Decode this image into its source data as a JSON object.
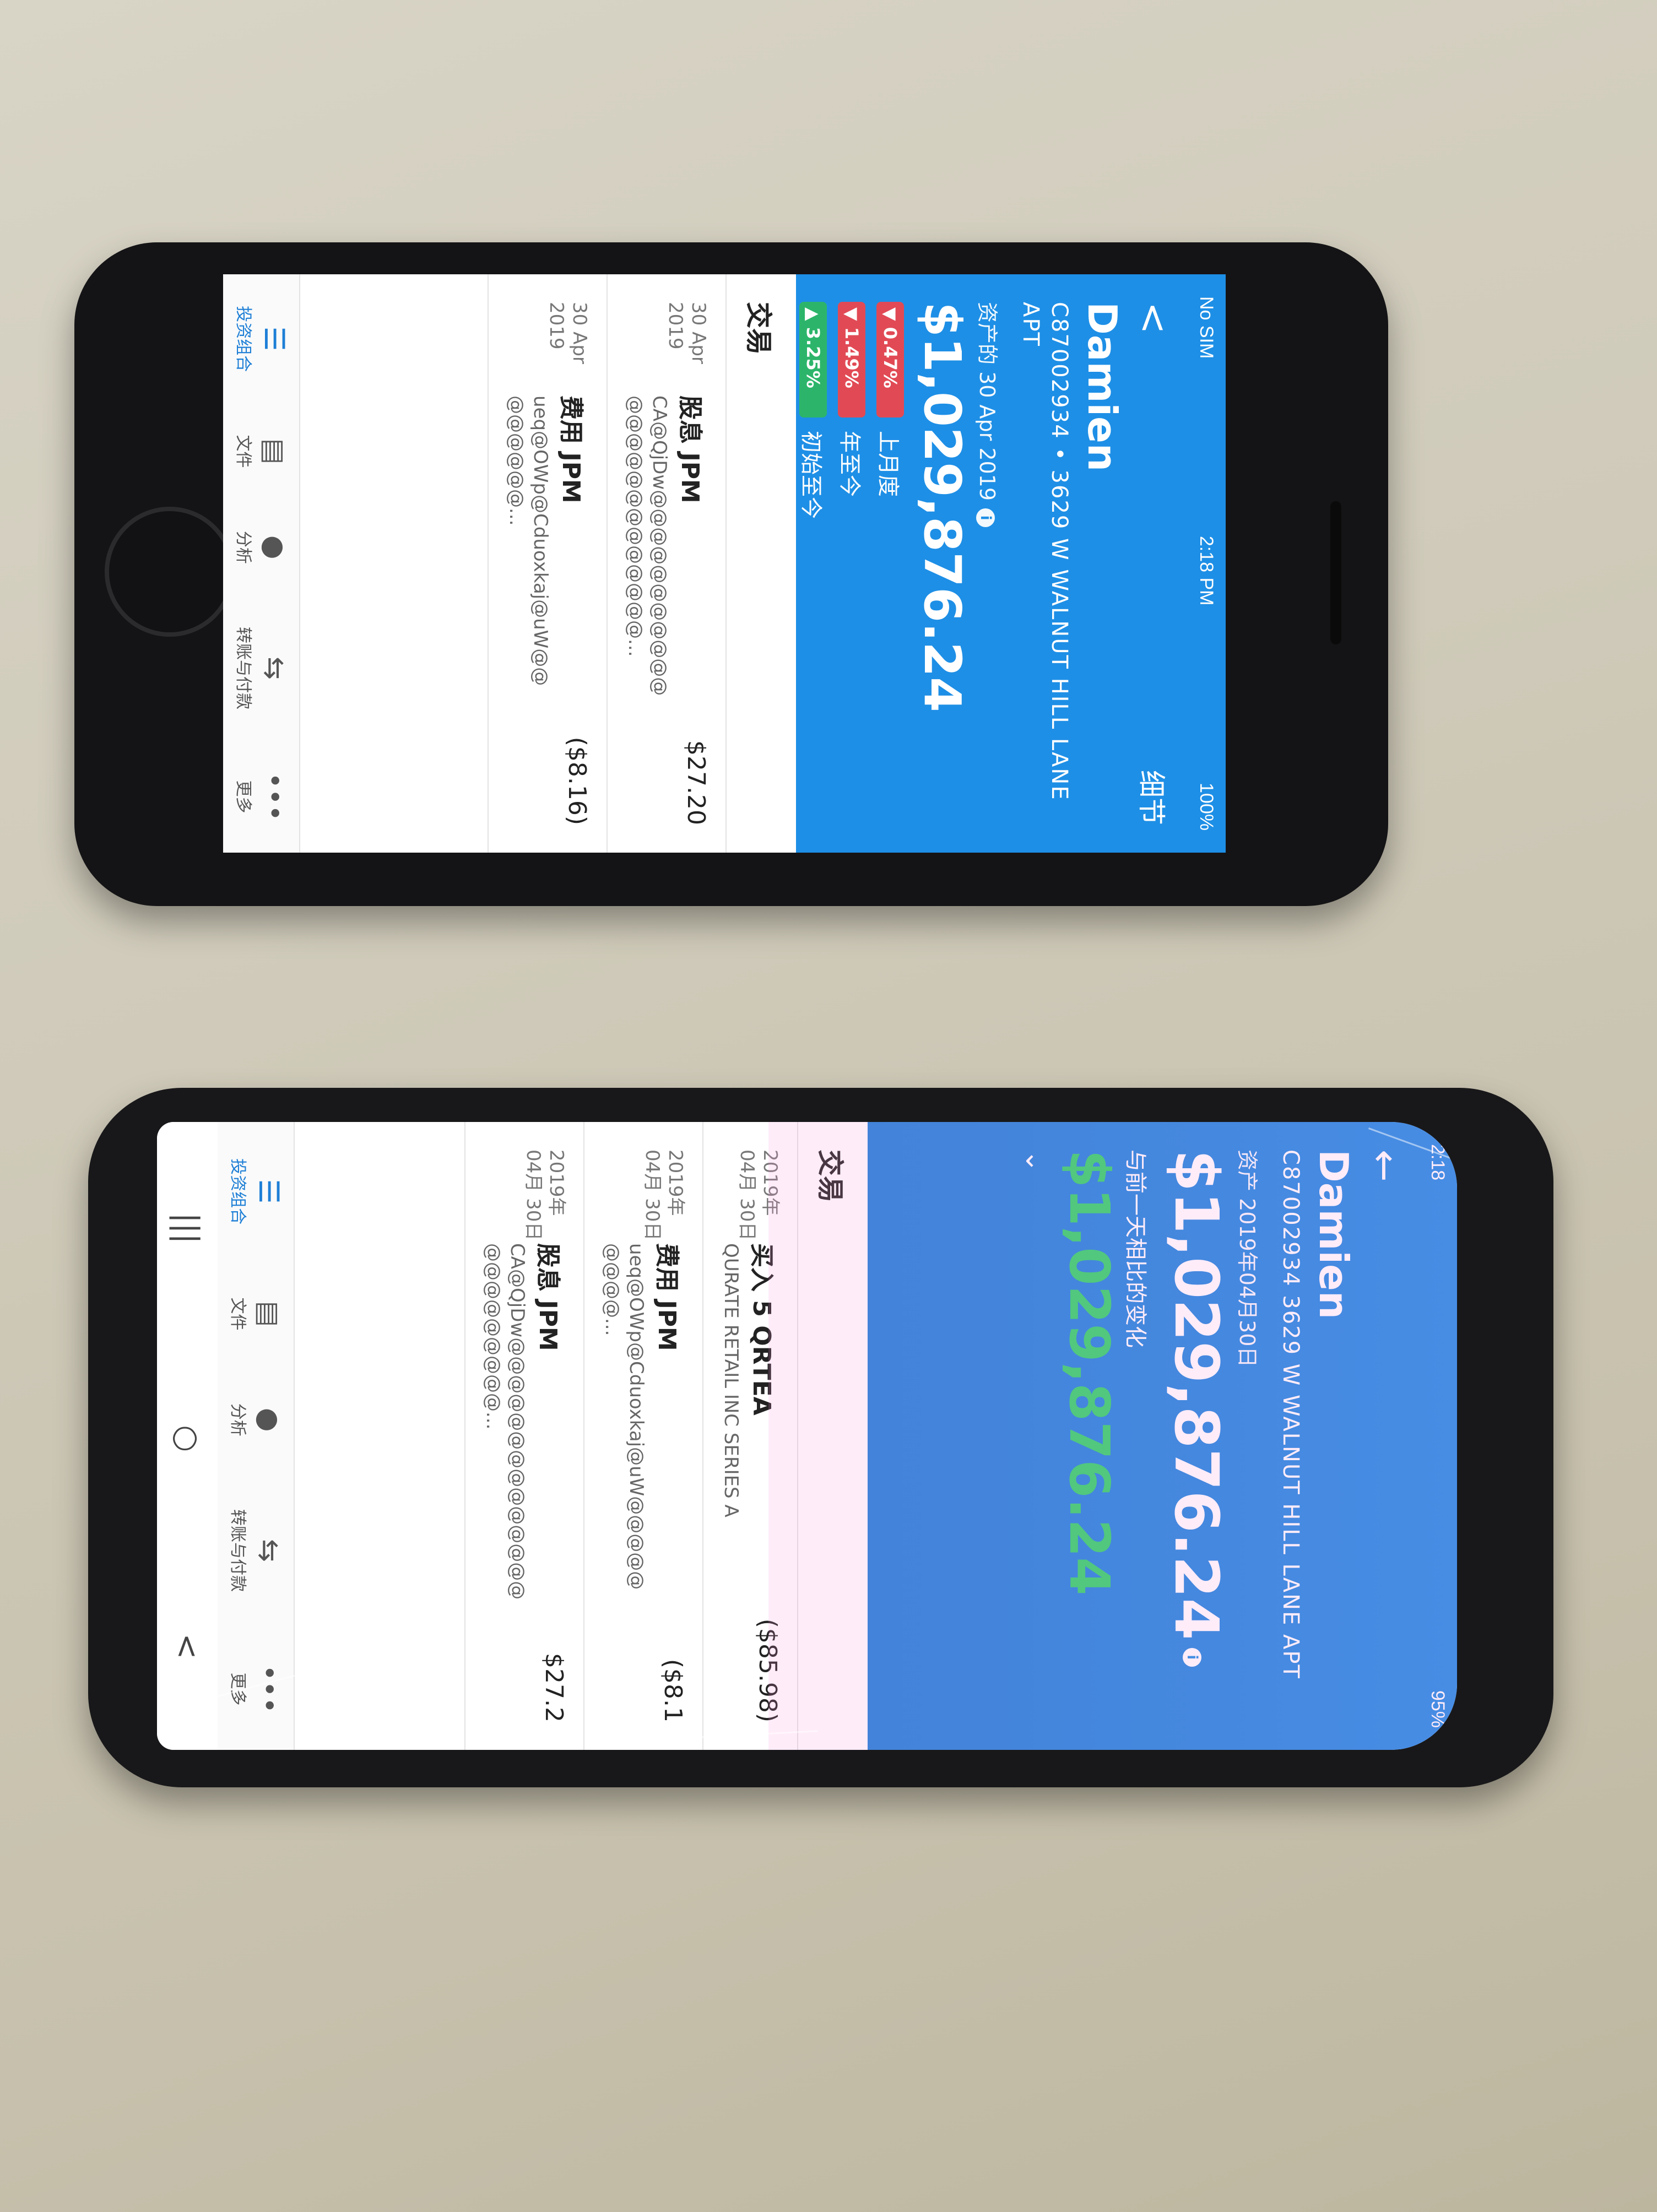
{
  "top_phone": {
    "status": {
      "carrier": "No SIM",
      "time": "2:18 PM",
      "battery": "100%"
    },
    "header": {
      "back": "<",
      "details": "细节",
      "name": "Damien",
      "account": "C87002934 • 3629 W WALNUT HILL LANE APT",
      "asset_label": "资产的 30 Apr 2019",
      "asset_value": "$1,029,876.24",
      "performance": [
        {
          "badge": "0.47%",
          "label": "上月度",
          "direction": "down"
        },
        {
          "badge": "1.49%",
          "label": "年至今",
          "direction": "down"
        },
        {
          "badge": "3.25%",
          "label": "初始至今",
          "direction": "up"
        }
      ]
    },
    "section_title": "交易",
    "transactions": [
      {
        "date": "30 Apr 2019",
        "type": "股息  JPM",
        "desc": "CA@QjDw@@@@@@@@@@@@@@@@@@@@@@@@...",
        "amount": "$27.20"
      },
      {
        "date": "30 Apr 2019",
        "type": "费用  JPM",
        "desc": "ueq@OWp@Cduoxkaj@uW@@@@@@@@...",
        "amount": "($8.16)"
      }
    ],
    "nav": [
      {
        "label": "投资组合",
        "icon": "database-icon",
        "active": true
      },
      {
        "label": "文件",
        "icon": "document-icon",
        "active": false
      },
      {
        "label": "分析",
        "icon": "lightbulb-icon",
        "active": false
      },
      {
        "label": "转账与付款",
        "icon": "transfer-icon",
        "active": false
      },
      {
        "label": "更多",
        "icon": "more-icon",
        "active": false
      }
    ]
  },
  "bottom_phone": {
    "status": {
      "time": "2:18",
      "battery": "95%"
    },
    "header": {
      "name": "Damien",
      "account": "C87002934 3629 W WALNUT HILL LANE APT",
      "asset_label": "资产 2019年04月30日",
      "asset_value": "$1,029,876.24",
      "change_label": "与前一天相比的变化",
      "change_value": "$1,029,876.24"
    },
    "section_title": "交易",
    "transactions": [
      {
        "date": "2019年 04月 30日",
        "type": "买入 5 QRTEA",
        "desc": "QURATE RETAIL INC SERIES A",
        "amount": "($85.98)"
      },
      {
        "date": "2019年 04月 30日",
        "type": "费用  JPM",
        "desc": "ueq@OWp@Cduoxkaj@uW@@@@@@@@@...",
        "amount": "($8.1"
      },
      {
        "date": "2019年 04月 30日",
        "type": "股息  JPM",
        "desc": "CA@QjDw@@@@@@@@@@@@@@@@@@@@@@@...",
        "amount": "$27.2"
      }
    ],
    "nav": [
      {
        "label": "投资组合",
        "icon": "database-icon",
        "active": true
      },
      {
        "label": "文件",
        "icon": "document-icon",
        "active": false
      },
      {
        "label": "分析",
        "icon": "lightbulb-icon",
        "active": false
      },
      {
        "label": "转账与付款",
        "icon": "transfer-icon",
        "active": false
      },
      {
        "label": "更多",
        "icon": "more-icon",
        "active": false
      }
    ],
    "android_nav": {
      "recents": "|||",
      "home": "○",
      "back": "<"
    }
  },
  "colors": {
    "brand_blue": "#1e8fe6",
    "gain_green": "#2bd36a",
    "loss_red": "#e14a55",
    "up_green": "#2cb56a"
  }
}
